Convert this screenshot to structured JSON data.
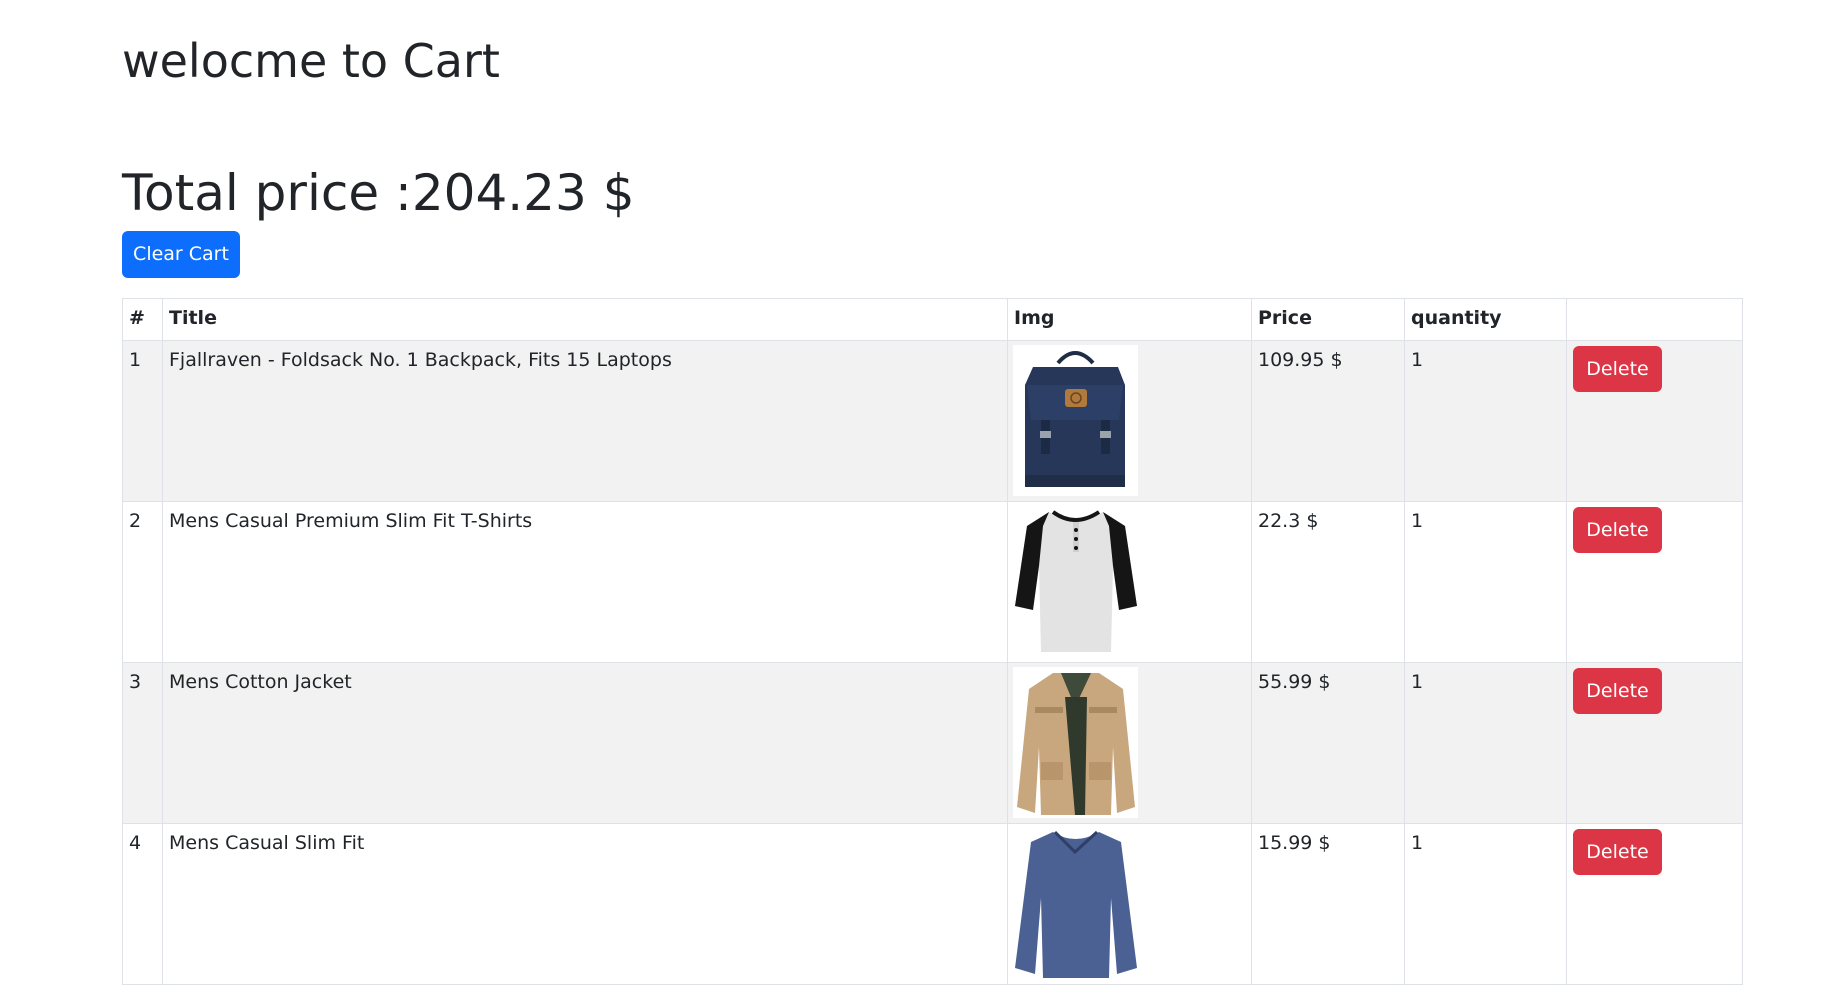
{
  "heading": "welocme to Cart",
  "total_label": "Total price :204.23 $",
  "clear_button_label": "Clear Cart",
  "table": {
    "headers": [
      "#",
      "Title",
      "Img",
      "Price",
      "quantity",
      ""
    ],
    "rows": [
      {
        "num": "1",
        "title": "Fjallraven - Foldsack No. 1 Backpack, Fits 15 Laptops",
        "image": "backpack-image",
        "price": "109.95 $",
        "quantity": "1",
        "action": "Delete"
      },
      {
        "num": "2",
        "title": "Mens Casual Premium Slim Fit T-Shirts",
        "image": "tshirt-image",
        "price": "22.3 $",
        "quantity": "1",
        "action": "Delete"
      },
      {
        "num": "3",
        "title": "Mens Cotton Jacket",
        "image": "jacket-image",
        "price": "55.99 $",
        "quantity": "1",
        "action": "Delete"
      },
      {
        "num": "4",
        "title": "Mens Casual Slim Fit",
        "image": "longsleeve-shirt-image",
        "price": "15.99 $",
        "quantity": "1",
        "action": "Delete"
      }
    ]
  },
  "colors": {
    "primary": "#0d6efd",
    "danger": "#dc3545",
    "stripe": "#f2f2f2"
  }
}
